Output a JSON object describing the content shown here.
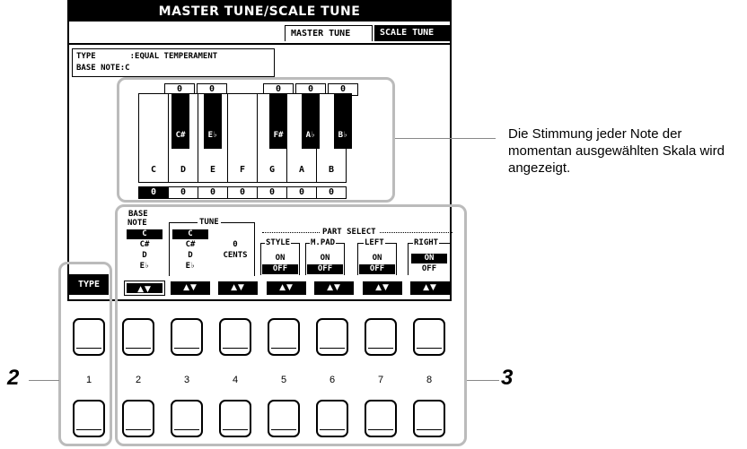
{
  "title": "MASTER TUNE/SCALE TUNE",
  "tabs": {
    "master": "MASTER TUNE",
    "scale": "SCALE TUNE"
  },
  "info": {
    "type_label": "TYPE",
    "type_value": ":EQUAL TEMPERAMENT",
    "base_label": "BASE NOTE:C"
  },
  "black_values": [
    "0",
    "0",
    "0",
    "0",
    "0"
  ],
  "black_keys": [
    "C#",
    "E♭",
    "F#",
    "A♭",
    "B♭"
  ],
  "white_keys": [
    "C",
    "D",
    "E",
    "F",
    "G",
    "A",
    "B"
  ],
  "white_values": [
    "0",
    "0",
    "0",
    "0",
    "0",
    "0",
    "0"
  ],
  "controls": {
    "base_note_label_1": "BASE",
    "base_note_label_2": "NOTE",
    "base_note_options": [
      "C",
      "C#",
      "D",
      "E♭"
    ],
    "tune_label": "TUNE",
    "tune_options": [
      "C",
      "C#",
      "D",
      "E♭"
    ],
    "tune_value": "0",
    "tune_unit": "CENTS",
    "part_select_label": "PART SELECT",
    "parts": [
      {
        "name": "STYLE",
        "on": "ON",
        "off": "OFF",
        "selected": "OFF"
      },
      {
        "name": "M.PAD",
        "on": "ON",
        "off": "OFF",
        "selected": "OFF"
      },
      {
        "name": "LEFT",
        "on": "ON",
        "off": "OFF",
        "selected": "OFF"
      },
      {
        "name": "RIGHT",
        "on": "ON",
        "off": "OFF",
        "selected": "ON"
      }
    ],
    "type_button": "TYPE",
    "arrow_glyph": "▲▼"
  },
  "button_numbers": [
    "1",
    "2",
    "3",
    "4",
    "5",
    "6",
    "7",
    "8"
  ],
  "callout_text": "Die Stimmung jeder Note der momentan ausgewählten Skala wird angezeigt.",
  "step_left": "2",
  "step_right": "3"
}
